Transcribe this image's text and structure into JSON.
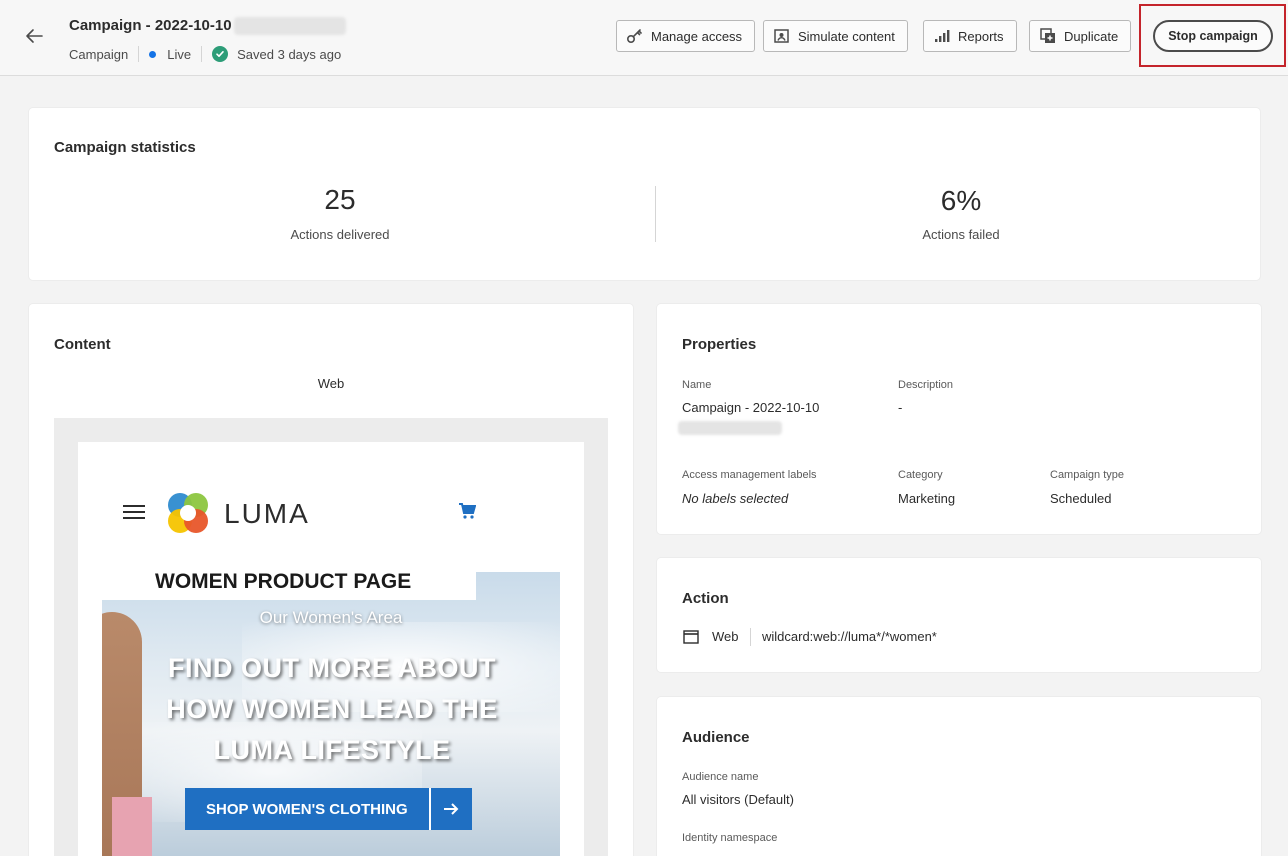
{
  "header": {
    "title": "Campaign - 2022-10-10",
    "meta": {
      "type": "Campaign",
      "status": "Live",
      "saved": "Saved 3 days ago"
    },
    "buttons": {
      "manage_access": "Manage access",
      "simulate_content": "Simulate content",
      "reports": "Reports",
      "duplicate": "Duplicate",
      "stop_campaign": "Stop campaign"
    }
  },
  "stats": {
    "title": "Campaign statistics",
    "delivered_value": "25",
    "delivered_label": "Actions delivered",
    "failed_value": "6%",
    "failed_label": "Actions failed"
  },
  "content": {
    "title": "Content",
    "channel": "Web",
    "preview": {
      "brand": "LUMA",
      "page_heading": "WOMEN PRODUCT PAGE",
      "hero_subtitle": "Our Women's Area",
      "hero_heading": "FIND OUT MORE ABOUT HOW WOMEN LEAD THE LUMA LIFESTYLE",
      "cta": "SHOP WOMEN'S CLOTHING"
    }
  },
  "properties": {
    "title": "Properties",
    "name_label": "Name",
    "name_value": "Campaign - 2022-10-10",
    "description_label": "Description",
    "description_value": "-",
    "access_label": "Access management labels",
    "access_value": "No labels selected",
    "category_label": "Category",
    "category_value": "Marketing",
    "type_label": "Campaign type",
    "type_value": "Scheduled"
  },
  "action": {
    "title": "Action",
    "channel": "Web",
    "surface": "wildcard:web://luma*/*women*"
  },
  "audience": {
    "title": "Audience",
    "name_label": "Audience name",
    "name_value": "All visitors (Default)",
    "namespace_label": "Identity namespace"
  },
  "colors": {
    "accent": "#1473e6",
    "success": "#2d9d78",
    "highlight": "#c4242b",
    "cta": "#1f6fc2"
  }
}
